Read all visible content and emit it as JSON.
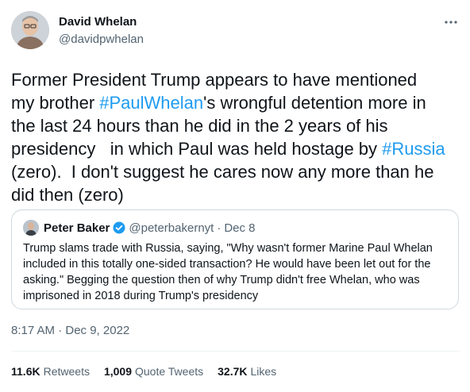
{
  "author": {
    "name": "David Whelan",
    "handle": "@davidpwhelan"
  },
  "tweet": {
    "part1": "Former President Trump appears to have mentioned\nmy brother ",
    "hashtag1": "#PaulWhelan",
    "part2": "'s wrongful detention more in\nthe last 24 hours than he did in the 2 years of his\npresidency   in which Paul was held hostage by ",
    "hashtag2": "#Russia",
    "part3": "\n(zero).  I don't suggest he cares now any more than he\ndid then (zero)"
  },
  "quote": {
    "name": "Peter Baker",
    "handle": "@peterbakernyt",
    "separator": "·",
    "date": "Dec 8",
    "text": "Trump slams trade with Russia, saying, \"Why wasn't former Marine Paul Whelan included in this totally one-sided transaction? He would have been let out for the asking.\" Begging the question then of why Trump didn't free Whelan, who was imprisoned in 2018 during Trump's presidency"
  },
  "timestamp": "8:17 AM · Dec 9, 2022",
  "stats": {
    "retweets_count": "11.6K",
    "retweets_label": "Retweets",
    "quotes_count": "1,009",
    "quotes_label": "Quote Tweets",
    "likes_count": "32.7K",
    "likes_label": "Likes"
  },
  "colors": {
    "link": "#1d9bf0",
    "secondary_text": "#536471",
    "verified": "#1d9bf0"
  },
  "icons": [
    "more-icon",
    "verified-badge-icon"
  ]
}
